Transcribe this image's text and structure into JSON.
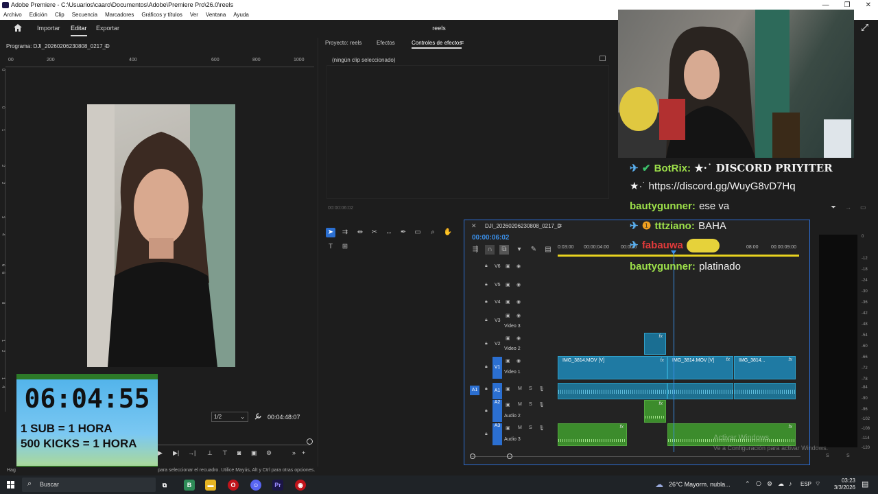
{
  "window": {
    "title": "Adobe Premiere - C:\\Usuarios\\caaro\\Documentos\\Adobe\\Premiere Pro\\26.0\\reels"
  },
  "menu": [
    "Archivo",
    "Edición",
    "Clip",
    "Secuencia",
    "Marcadores",
    "Gráficos y títulos",
    "Ver",
    "Ventana",
    "Ayuda"
  ],
  "workspace": {
    "tabs": [
      "Importar",
      "Editar",
      "Exportar"
    ],
    "active": "Editar",
    "project_title": "reels"
  },
  "program": {
    "title": "Programa: DJI_20260206230808_0217_D",
    "ruler_labels": [
      "00",
      "200",
      "400",
      "600",
      "800",
      "1000"
    ],
    "left_ruler_labels": [
      "0",
      "0",
      "1",
      "2",
      "2",
      "3",
      "4",
      "6",
      "6",
      "8",
      "1",
      "2",
      "1",
      "4",
      "1",
      "6",
      "2"
    ],
    "zoom": "1/2",
    "timecode": "00:04:48:07"
  },
  "effects": {
    "tabs": [
      "Proyecto: reels",
      "Efectos",
      "Controles de efectos"
    ],
    "active_tab": "Controles de efectos",
    "empty_message": "(ningún clip seleccionado)",
    "timecode": "00:00:06:02"
  },
  "timeline": {
    "sequence_name": "DJI_20260206230808_0217_D",
    "timecode": "00:00:06:02",
    "ruler_labels": [
      "0:03:00",
      "00:00:04:00",
      "00:00:0",
      "08:00",
      "00:00:09:00"
    ],
    "video_tracks": [
      {
        "id": "V6",
        "name": ""
      },
      {
        "id": "V5",
        "name": ""
      },
      {
        "id": "V4",
        "name": ""
      },
      {
        "id": "V3",
        "name": "Video 3"
      },
      {
        "id": "V2",
        "name": "Video 2"
      },
      {
        "id": "V1",
        "name": "Video 1"
      }
    ],
    "audio_tracks": [
      {
        "id": "A1",
        "name": ""
      },
      {
        "id": "A2",
        "name": "Audio 2"
      },
      {
        "id": "A3",
        "name": "Audio 3"
      }
    ],
    "clips": [
      {
        "label": "IMG_3814.MOV [V]"
      },
      {
        "label": "IMG_3814.MOV [V]"
      },
      {
        "label": "IMG_3814..."
      }
    ],
    "fx_label": "fx",
    "track_button_m": "M",
    "track_button_s": "S"
  },
  "meter": {
    "db_labels": [
      "0",
      "-12",
      "-18",
      "-24",
      "-30",
      "-36",
      "-42",
      "-48",
      "-54",
      "-60",
      "-66",
      "-72",
      "-78",
      "-84",
      "-90",
      "-96",
      "-102",
      "-108",
      "-114",
      "-120"
    ],
    "s_labels": [
      "S",
      "S"
    ]
  },
  "chat": {
    "lines": [
      {
        "user": "BotRix:",
        "msg": "★·˙ DISCORD PRIYITER"
      },
      {
        "user": "",
        "msg": "★·˙ https://discord.gg/WuyG8vD7Hq"
      },
      {
        "user": "bautygunner:",
        "msg": "ese va"
      },
      {
        "user": "tttziano:",
        "msg": "BAHA"
      },
      {
        "user": "fabauwa",
        "msg": ""
      },
      {
        "user": "bautygunner:",
        "msg": "platinado"
      }
    ]
  },
  "timer": {
    "value": "06:04:55",
    "line1": "1 SUB = 1 HORA",
    "line2": "500 KICKS = 1 HORA"
  },
  "status": {
    "left": "Hag",
    "right": "para seleccionar el recuadro. Utilice Mayús, Alt y Ctrl para otras opciones."
  },
  "watermark": {
    "line1": "Activar Windows",
    "line2": "Ve a Configuración para activar Windows."
  },
  "taskbar": {
    "search": "Buscar",
    "weather": "26°C  Mayorm. nubla...",
    "lang": "ESP",
    "time": "03:23",
    "date": "3/3/2026"
  }
}
